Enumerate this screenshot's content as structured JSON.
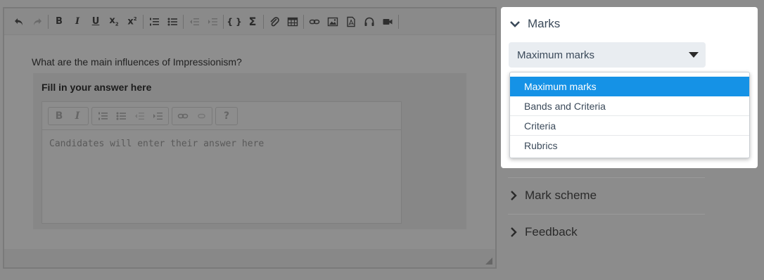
{
  "editor": {
    "toolbar": {
      "items": [
        "undo-icon",
        "redo-icon",
        "|",
        "bold-icon",
        "italic-icon",
        "underline-icon",
        "subscript-icon",
        "superscript-icon",
        "|",
        "numbered-list-icon",
        "bulleted-list-icon",
        "|",
        "outdent-icon",
        "indent-icon",
        "|",
        "code-braces-icon",
        "sigma-icon",
        "|",
        "attachment-icon",
        "table-icon",
        "|",
        "link-icon",
        "image-icon",
        "pdf-icon",
        "audio-icon",
        "video-icon"
      ]
    },
    "question": "What are the main influences of Impressionism?",
    "answer_title": "Fill in your answer here",
    "answer_placeholder": "Candidates will enter their answer here",
    "inner_help": "?"
  },
  "marks": {
    "header": "Marks",
    "selected_value": "Maximum marks",
    "options": [
      "Maximum marks",
      "Bands and Criteria",
      "Criteria",
      "Rubrics"
    ],
    "selected_index": 0
  },
  "sections": [
    {
      "label": "Mark scheme"
    },
    {
      "label": "Feedback"
    }
  ],
  "colors": {
    "overlay": "#8c8c8c",
    "accent": "#1592e6",
    "text": "#3b4a5a"
  }
}
